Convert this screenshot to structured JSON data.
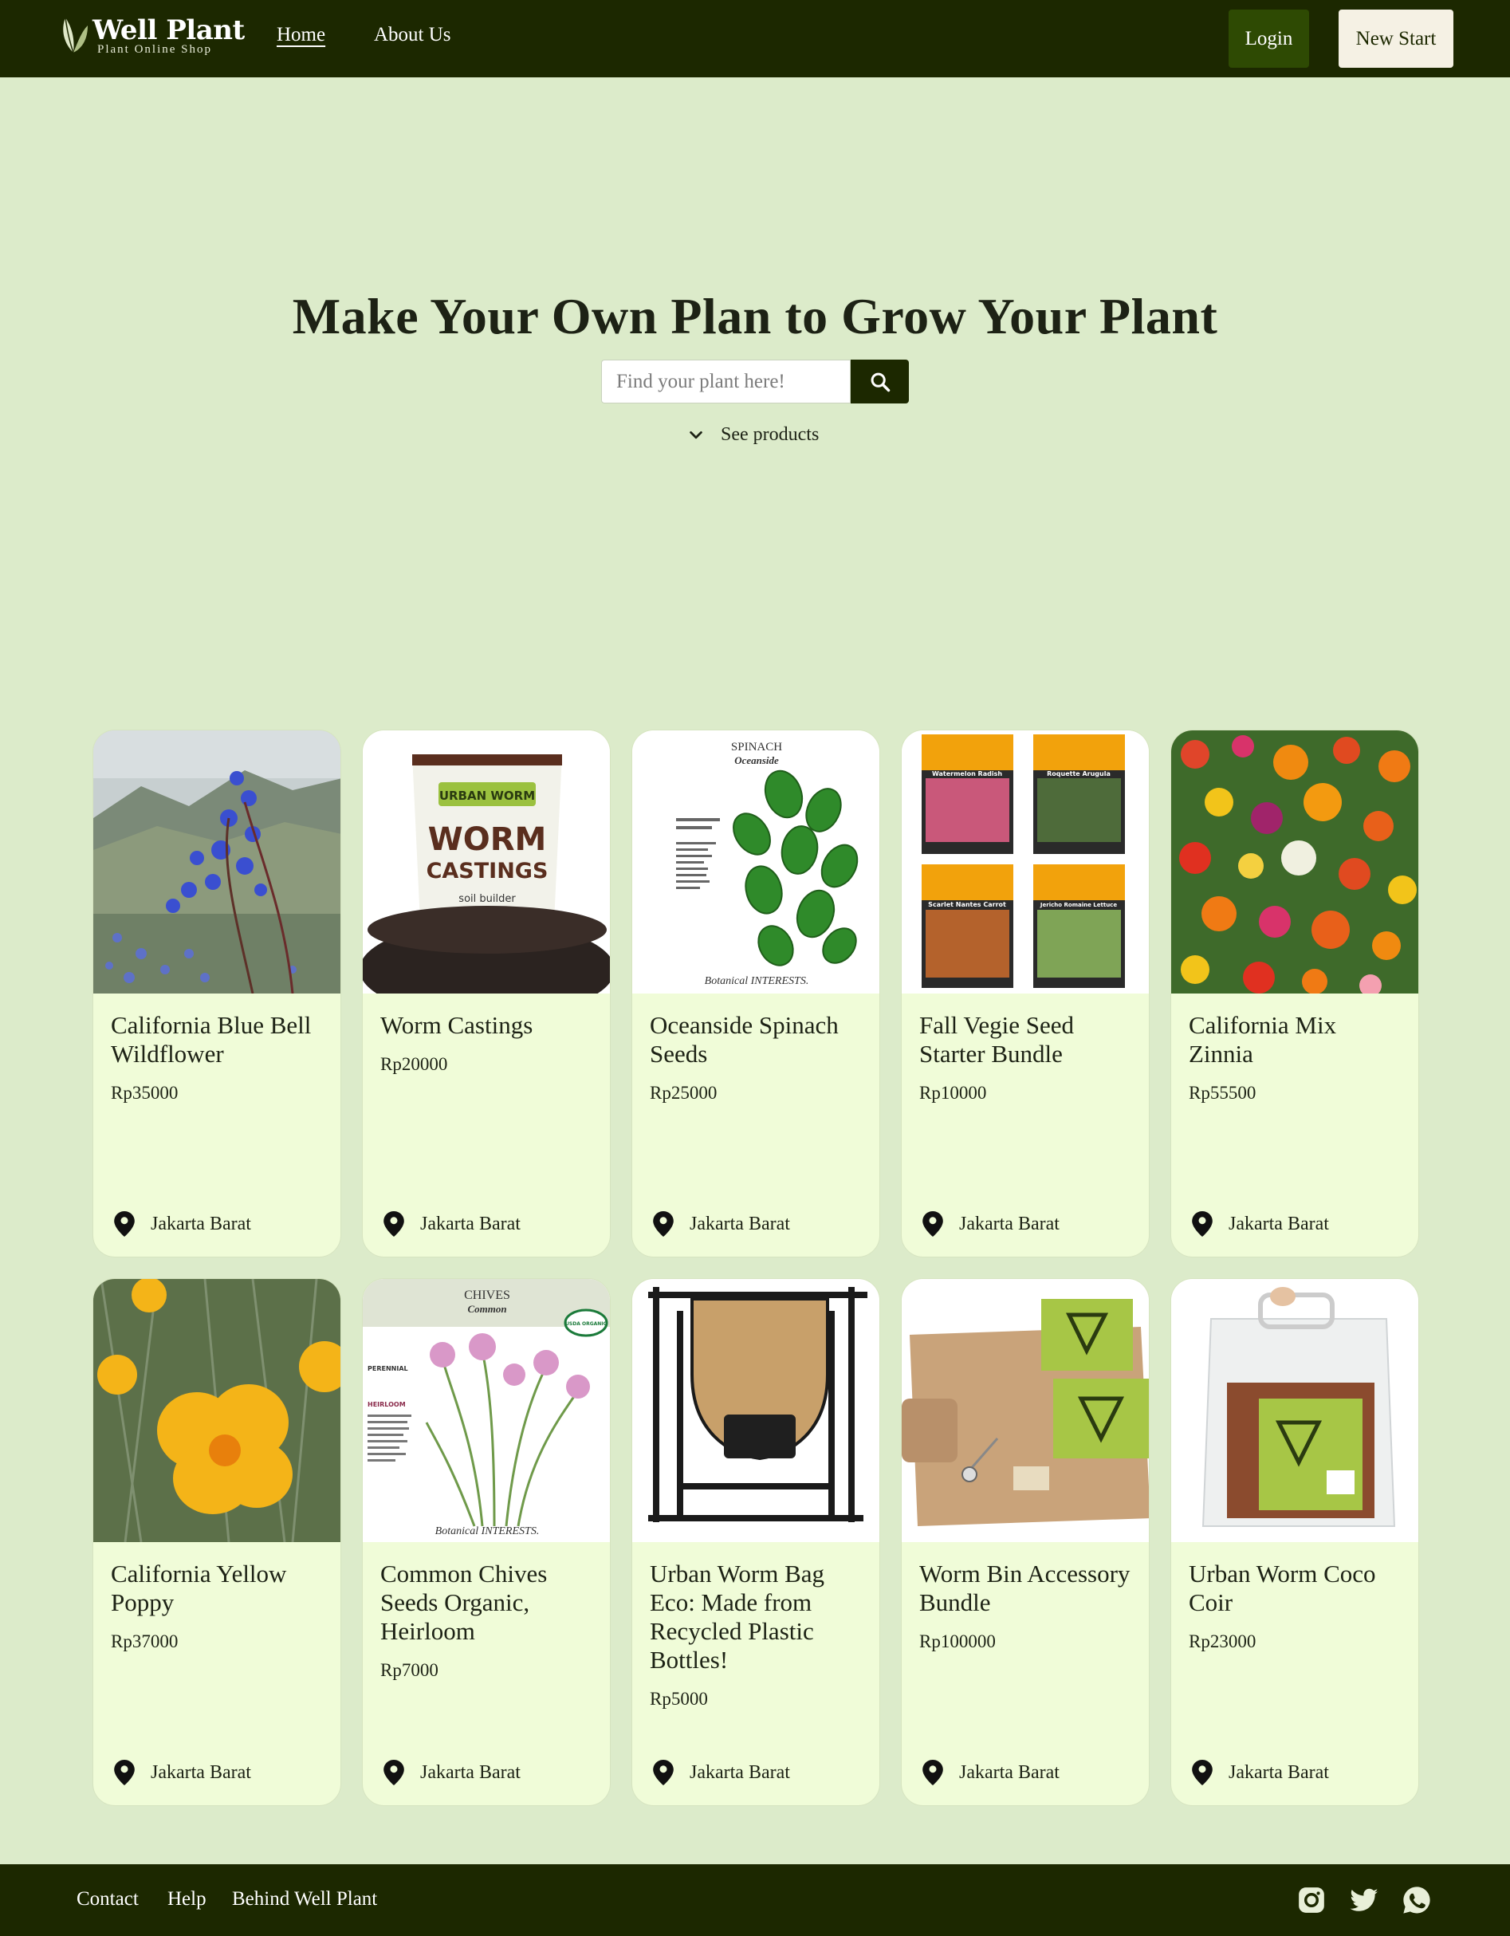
{
  "nav": {
    "brand_name": "Well Plant",
    "brand_tagline": "Plant Online Shop",
    "home_label": "Home",
    "about_label": "About Us",
    "login_label": "Login",
    "new_start_label": "New Start"
  },
  "hero": {
    "title": "Make Your Own Plan to Grow Your Plant",
    "search_placeholder": "Find your plant here!",
    "see_products_label": "See products"
  },
  "products": [
    {
      "name": "California Blue Bell Wildflower",
      "price": "Rp35000",
      "location": "Jakarta Barat"
    },
    {
      "name": "Worm Castings",
      "price": "Rp20000",
      "location": "Jakarta Barat"
    },
    {
      "name": "Oceanside Spinach Seeds",
      "price": "Rp25000",
      "location": "Jakarta Barat"
    },
    {
      "name": "Fall Vegie Seed Starter Bundle",
      "price": "Rp10000",
      "location": "Jakarta Barat"
    },
    {
      "name": "California Mix Zinnia",
      "price": "Rp55500",
      "location": "Jakarta Barat"
    },
    {
      "name": "California Yellow Poppy",
      "price": "Rp37000",
      "location": "Jakarta Barat"
    },
    {
      "name": "Common Chives Seeds Organic, Heirloom",
      "price": "Rp7000",
      "location": "Jakarta Barat"
    },
    {
      "name": "Urban Worm Bag Eco: Made from Recycled Plastic Bottles!",
      "price": "Rp5000",
      "location": "Jakarta Barat"
    },
    {
      "name": "Worm Bin Accessory Bundle",
      "price": "Rp100000",
      "location": "Jakarta Barat"
    },
    {
      "name": "Urban Worm Coco Coir",
      "price": "Rp23000",
      "location": "Jakarta Barat"
    }
  ],
  "images": {
    "worm_bag_brand": "URBAN WORM",
    "worm_bag_line1": "WORM",
    "worm_bag_line2": "CASTINGS",
    "worm_bag_sub": "soil builder",
    "spinach_head": "SPINACH",
    "spinach_name": "Oceanside",
    "spinach_brand": "Botanical INTERESTS.",
    "seed_labels": [
      "Watermelon Radish",
      "Roquette Arugula",
      "Scarlet Nantes Carrot",
      "Jericho Romaine Lettuce"
    ],
    "chives_head": "CHIVES",
    "chives_name": "Common",
    "chives_badge": "USDA ORGANIC",
    "chives_note1": "PERENNIAL",
    "chives_note2": "HEIRLOOM",
    "chives_brand": "Botanical INTERESTS."
  },
  "footer": {
    "contact_label": "Contact",
    "help_label": "Help",
    "behind_label": "Behind Well Plant"
  },
  "icons": {
    "search": "search-icon",
    "chevron": "chevron-down-icon",
    "location": "location-pin-icon",
    "instagram": "instagram-icon",
    "twitter": "twitter-icon",
    "whatsapp": "whatsapp-icon"
  },
  "colors": {
    "nav_bg": "#1c2800",
    "page_bg": "#dcebca",
    "card_bg": "#f0fcd8",
    "login_bg": "#2e4a03",
    "new_start_bg": "#f5f1e4"
  }
}
